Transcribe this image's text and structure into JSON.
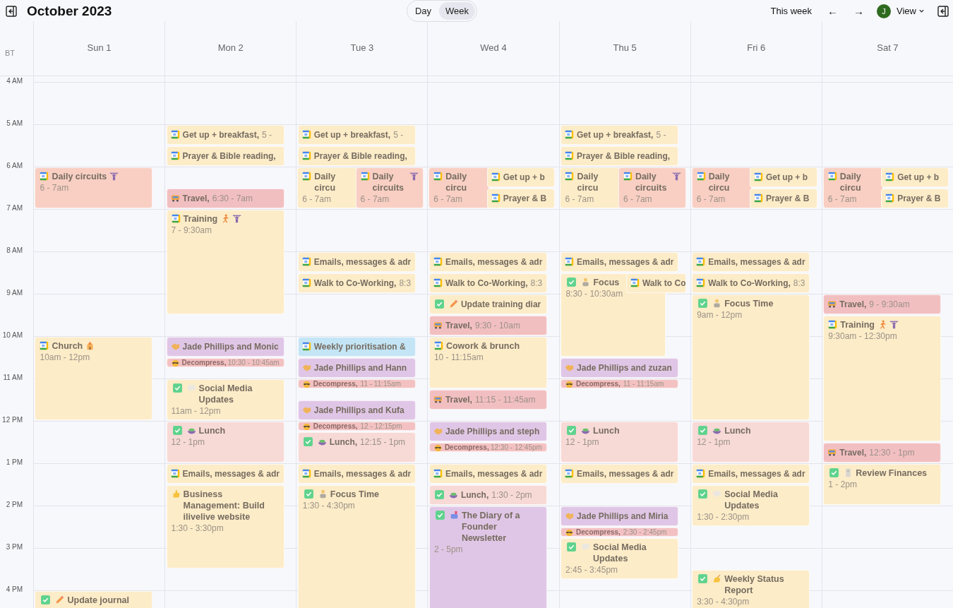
{
  "header": {
    "title": "October 2023",
    "views": [
      {
        "label": "Day",
        "selected": false
      },
      {
        "label": "Week",
        "selected": true
      }
    ],
    "today": "This week",
    "prev": "←",
    "next": "→",
    "avatar": "J",
    "view_menu": "View"
  },
  "timezone": "BT",
  "hours": [
    "4 AM",
    "5 AM",
    "6 AM",
    "7 AM",
    "8 AM",
    "9 AM",
    "10 AM",
    "11 AM",
    "12 PM",
    "1 PM",
    "2 PM",
    "3 PM",
    "4 PM"
  ],
  "days": [
    {
      "label": "Sun 1",
      "events": [
        {
          "title": "Daily circuits",
          "time": "6 - 7am",
          "color": "#f9cfc3"
        },
        {
          "title": "Church",
          "time": "10am - 12pm",
          "color": "#fcecc8"
        },
        {
          "title": "Update journal",
          "color": "#fcecc8",
          "done": true
        }
      ]
    },
    {
      "label": "Mon 2",
      "events": [
        {
          "title": "Get up + breakfast,",
          "time": "5 -",
          "color": "#fcecc8"
        },
        {
          "title": "Prayer & Bible reading,",
          "color": "#fcecc8"
        },
        {
          "title": "Travel,",
          "time": "6:30 - 7am",
          "color": "#f2bfc1"
        },
        {
          "title": "Training",
          "time": "7 - 9:30am",
          "color": "#fcecc8"
        },
        {
          "title": "Jade Phillips and Monic",
          "color": "#e0c6e6"
        },
        {
          "title": "Decompress,",
          "time": "10:30 - 10:45am",
          "color": "#f3c1c2"
        },
        {
          "title": "Social Media Updates",
          "time": "11am - 12pm",
          "color": "#fcecc8",
          "done": true
        },
        {
          "title": "Lunch",
          "time": "12 - 1pm",
          "color": "#f7d9d6",
          "done": true
        },
        {
          "title": "Emails, messages & adr",
          "color": "#fcecc8"
        },
        {
          "title": "Business Management: Build ilivelive website",
          "time": "1:30 - 3:30pm",
          "color": "#fcecc8"
        }
      ]
    },
    {
      "label": "Tue 3",
      "events": [
        {
          "title": "Get up + breakfast,",
          "time": "5 -",
          "color": "#fcecc8"
        },
        {
          "title": "Prayer & Bible reading,",
          "color": "#fcecc8"
        },
        {
          "title": "Daily circu",
          "time": "6 - 7am",
          "color": "#fcecc8"
        },
        {
          "title": "Daily circuits",
          "time": "6 - 7am",
          "color": "#f9cfc3"
        },
        {
          "title": "Emails, messages & adr",
          "color": "#fcecc8"
        },
        {
          "title": "Walk to Co-Working,",
          "time": "8:3",
          "color": "#fcecc8"
        },
        {
          "title": "Weekly prioritisation &",
          "color": "#c3e5f6"
        },
        {
          "title": "Jade Phillips and Hann",
          "color": "#e0c6e6"
        },
        {
          "title": "Decompress,",
          "time": "11 - 11:15am",
          "color": "#f3c1c2"
        },
        {
          "title": "Jade Phillips and Kufa",
          "color": "#e0c6e6"
        },
        {
          "title": "Decompress,",
          "time": "12 - 12:15pm",
          "color": "#f3c1c2"
        },
        {
          "title": "Lunch,",
          "time": "12:15 - 1pm",
          "color": "#f7d9d6",
          "done": true
        },
        {
          "title": "Emails, messages & adr",
          "color": "#fcecc8"
        },
        {
          "title": "Focus Time",
          "time": "1:30 - 4:30pm",
          "color": "#fcecc8",
          "done": true
        }
      ]
    },
    {
      "label": "Wed 4",
      "events": [
        {
          "title": "Daily circu",
          "time": "6 - 7am",
          "color": "#f9cfc3"
        },
        {
          "title": "Get up + b",
          "color": "#fcecc8"
        },
        {
          "title": "Prayer & B",
          "color": "#fcecc8"
        },
        {
          "title": "Emails, messages & adr",
          "color": "#fcecc8"
        },
        {
          "title": "Walk to Co-Working,",
          "time": "8:3",
          "color": "#fcecc8"
        },
        {
          "title": "Update training diar",
          "color": "#fcecc8",
          "done": true
        },
        {
          "title": "Travel,",
          "time": "9:30 - 10am",
          "color": "#f2bfc1"
        },
        {
          "title": "Cowork & brunch",
          "time": "10 - 11:15am",
          "color": "#fcecc8"
        },
        {
          "title": "Travel,",
          "time": "11:15 - 11:45am",
          "color": "#f2bfc1"
        },
        {
          "title": "Jade Phillips and steph",
          "color": "#e0c6e6"
        },
        {
          "title": "Decompress,",
          "time": "12:30 - 12:45pm",
          "color": "#f3c1c2"
        },
        {
          "title": "Emails, messages & adr",
          "color": "#fcecc8"
        },
        {
          "title": "Lunch,",
          "time": "1:30 - 2pm",
          "color": "#f7d9d6",
          "done": true
        },
        {
          "title": "The Diary of a Founder Newsletter",
          "time": "2 - 5pm",
          "color": "#e0c6e6",
          "done": true
        }
      ]
    },
    {
      "label": "Thu 5",
      "events": [
        {
          "title": "Get up + breakfast,",
          "time": "5 -",
          "color": "#fcecc8"
        },
        {
          "title": "Prayer & Bible reading,",
          "color": "#fcecc8"
        },
        {
          "title": "Daily circu",
          "time": "6 - 7am",
          "color": "#fcecc8"
        },
        {
          "title": "Daily circuits",
          "time": "6 - 7am",
          "color": "#f9cfc3"
        },
        {
          "title": "Emails, messages & adr",
          "color": "#fcecc8"
        },
        {
          "title": "Focus",
          "time": "8:30 - 10:30am",
          "color": "#fcecc8",
          "done": true
        },
        {
          "title": "Walk to Co",
          "color": "#fcecc8"
        },
        {
          "title": "Jade Phillips and zuzan",
          "color": "#e0c6e6"
        },
        {
          "title": "Decompress,",
          "time": "11 - 11:15am",
          "color": "#f3c1c2"
        },
        {
          "title": "Lunch",
          "time": "12 - 1pm",
          "color": "#f7d9d6",
          "done": true
        },
        {
          "title": "Emails, messages & adr",
          "color": "#fcecc8"
        },
        {
          "title": "Jade Phillips and Miria",
          "color": "#e0c6e6"
        },
        {
          "title": "Decompress,",
          "time": "2:30 - 2:45pm",
          "color": "#f3c1c2"
        },
        {
          "title": "Social Media Updates",
          "time": "2:45 - 3:45pm",
          "color": "#fcecc8",
          "done": true
        }
      ]
    },
    {
      "label": "Fri 6",
      "events": [
        {
          "title": "Daily circu",
          "time": "6 - 7am",
          "color": "#f9cfc3"
        },
        {
          "title": "Get up + b",
          "color": "#fcecc8"
        },
        {
          "title": "Prayer & B",
          "color": "#fcecc8"
        },
        {
          "title": "Emails, messages & adr",
          "color": "#fcecc8"
        },
        {
          "title": "Walk to Co-Working,",
          "time": "8:3",
          "color": "#fcecc8"
        },
        {
          "title": "Focus Time",
          "time": "9am - 12pm",
          "color": "#fcecc8",
          "done": true
        },
        {
          "title": "Lunch",
          "time": "12 - 1pm",
          "color": "#f7d9d6",
          "done": true
        },
        {
          "title": "Emails, messages & adr",
          "color": "#fcecc8"
        },
        {
          "title": "Social Media Updates",
          "time": "1:30 - 2:30pm",
          "color": "#fcecc8",
          "done": true
        },
        {
          "title": "Weekly Status Report",
          "time": "3:30 - 4:30pm",
          "color": "#fcecc8",
          "done": true
        }
      ]
    },
    {
      "label": "Sat 7",
      "events": [
        {
          "title": "Daily circu",
          "time": "6 - 7am",
          "color": "#f9cfc3"
        },
        {
          "title": "Get up + b",
          "color": "#fcecc8"
        },
        {
          "title": "Prayer & B",
          "color": "#fcecc8"
        },
        {
          "title": "Travel,",
          "time": "9 - 9:30am",
          "color": "#f2bfc1"
        },
        {
          "title": "Training",
          "time": "9:30am - 12:30pm",
          "color": "#fcecc8"
        },
        {
          "title": "Travel,",
          "time": "12:30 - 1pm",
          "color": "#f2bfc1"
        },
        {
          "title": "Review Finances",
          "time": "1 - 2pm",
          "color": "#fcecc8",
          "done": true
        }
      ]
    }
  ]
}
